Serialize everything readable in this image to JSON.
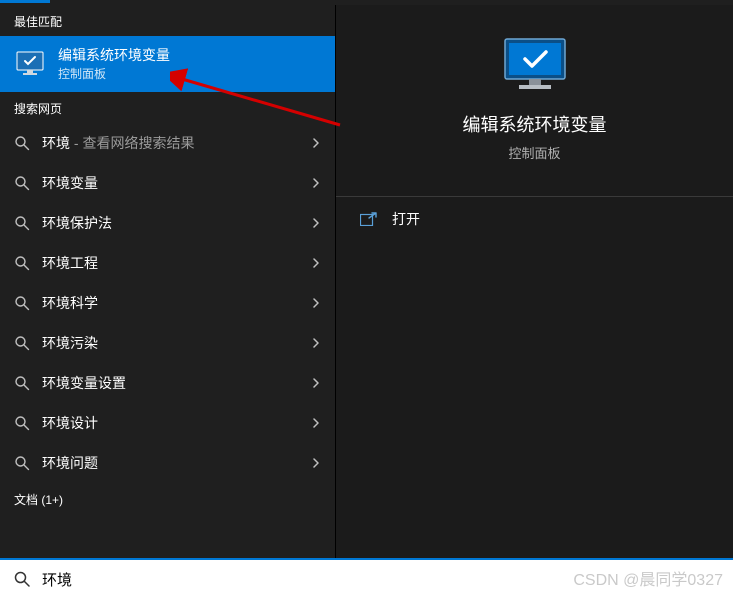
{
  "sections": {
    "best_match_header": "最佳匹配",
    "web_search_header": "搜索网页",
    "documents_header": "文档 (1+)"
  },
  "best_match": {
    "title": "编辑系统环境变量",
    "subtitle": "控制面板"
  },
  "web_results": [
    {
      "label": "环境",
      "suffix": " - 查看网络搜索结果"
    },
    {
      "label": "环境变量",
      "suffix": ""
    },
    {
      "label": "环境保护法",
      "suffix": ""
    },
    {
      "label": "环境工程",
      "suffix": ""
    },
    {
      "label": "环境科学",
      "suffix": ""
    },
    {
      "label": "环境污染",
      "suffix": ""
    },
    {
      "label": "环境变量设置",
      "suffix": ""
    },
    {
      "label": "环境设计",
      "suffix": ""
    },
    {
      "label": "环境问题",
      "suffix": ""
    }
  ],
  "detail": {
    "title": "编辑系统环境变量",
    "subtitle": "控制面板",
    "open_label": "打开"
  },
  "search": {
    "value": "环境"
  },
  "watermark": "CSDN @晨同学0327",
  "colors": {
    "accent": "#0078d4",
    "bg_dark": "#1f1f1f"
  }
}
